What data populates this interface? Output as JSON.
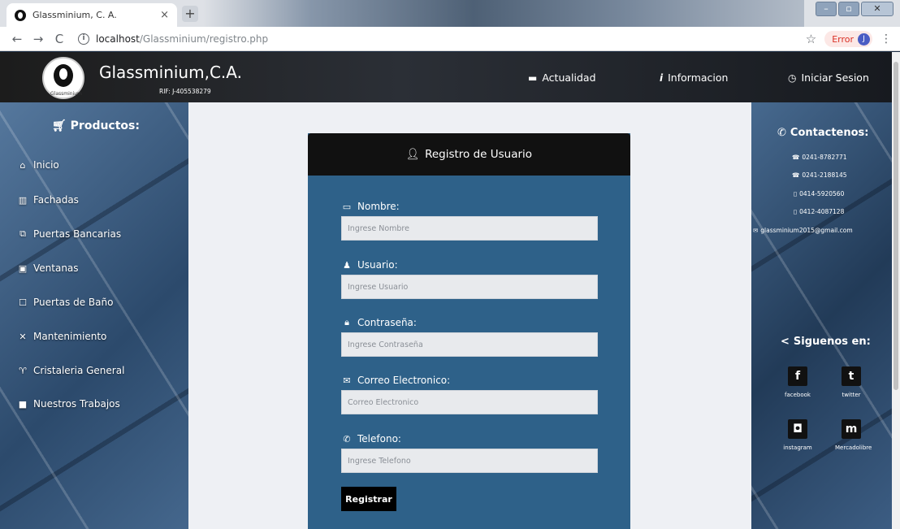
{
  "browser": {
    "tab_title": "Glassminium, C. A.",
    "tab_close": "×",
    "new_tab": "+",
    "url_host": "localhost",
    "url_path": "/Glassminium/registro.php",
    "error_label": "Error",
    "avatar_letter": "J"
  },
  "header": {
    "logo_text": "Glassminium",
    "brand": "Glassminium,C.A.",
    "rif": "RIF: J-405538279",
    "nav": [
      {
        "label": "Actualidad",
        "icon": "calendar-icon"
      },
      {
        "label": "Informacion",
        "icon": "info-icon"
      },
      {
        "label": "Iniciar Sesion",
        "icon": "clock-icon"
      }
    ]
  },
  "sidebar": {
    "title": "Productos:",
    "items": [
      {
        "label": "Inicio",
        "icon": "home-icon"
      },
      {
        "label": "Fachadas",
        "icon": "columns-icon"
      },
      {
        "label": "Puertas Bancarias",
        "icon": "copy-icon"
      },
      {
        "label": "Ventanas",
        "icon": "window-icon"
      },
      {
        "label": "Puertas de Baño",
        "icon": "door-icon"
      },
      {
        "label": "Mantenimiento",
        "icon": "tools-icon"
      },
      {
        "label": "Cristaleria General",
        "icon": "glass-icon"
      },
      {
        "label": "Nuestros Trabajos",
        "icon": "briefcase-icon"
      }
    ]
  },
  "form": {
    "title": "Registro de Usuario",
    "fields": [
      {
        "label": "Nombre:",
        "placeholder": "Ingrese Nombre",
        "icon": "id-card-icon"
      },
      {
        "label": "Usuario:",
        "placeholder": "Ingrese Usuario",
        "icon": "user-icon"
      },
      {
        "label": "Contraseña:",
        "placeholder": "Ingrese Contraseña",
        "icon": "lock-icon"
      },
      {
        "label": "Correo Electronico:",
        "placeholder": "Correo Electronico",
        "icon": "envelope-icon"
      },
      {
        "label": "Telefono:",
        "placeholder": "Ingrese Telefono",
        "icon": "phone-icon"
      }
    ],
    "submit_label": "Registrar"
  },
  "contact": {
    "title": "Contactenos:",
    "lines": [
      {
        "text": "0241-8782771",
        "icon": "phone-alt-icon"
      },
      {
        "text": "0241-2188145",
        "icon": "phone-alt-icon"
      },
      {
        "text": "0414-5920560",
        "icon": "mobile-icon"
      },
      {
        "text": "0412-4087128",
        "icon": "mobile-icon"
      },
      {
        "text": "glassminium2015@gmail.com",
        "icon": "envelope-icon"
      }
    ]
  },
  "social": {
    "title": "Siguenos en:",
    "links": [
      {
        "label": "facebook",
        "glyph": "f"
      },
      {
        "label": "twitter",
        "glyph": "t"
      },
      {
        "label": "instagram",
        "glyph": "◘"
      },
      {
        "label": "Mercadolibre",
        "glyph": "m"
      }
    ]
  }
}
